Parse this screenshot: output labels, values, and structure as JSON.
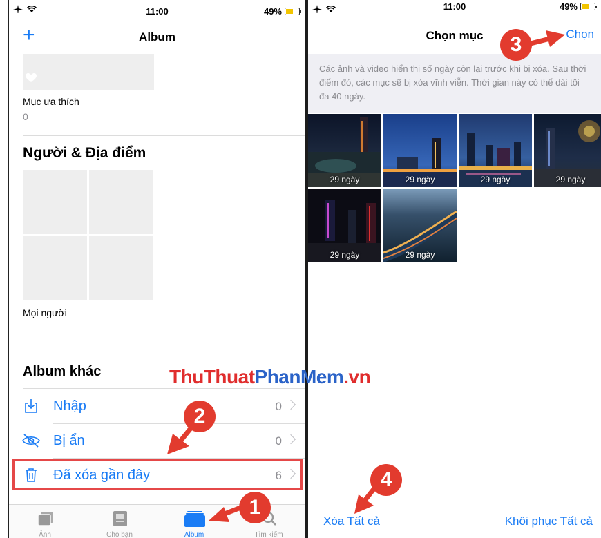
{
  "left_screen": {
    "status": {
      "time": "11:00",
      "battery": "49%",
      "battery_level": 0.49
    },
    "nav": {
      "title": "Album",
      "add_label": "+"
    },
    "favorites": {
      "label": "Mục ưa thích",
      "count": "0"
    },
    "people_places": {
      "title": "Người & Địa điểm",
      "people_label": "Mọi người"
    },
    "other_albums": {
      "title": "Album khác",
      "items": [
        {
          "label": "Nhập",
          "count": "0",
          "icon": "import-icon"
        },
        {
          "label": "Bị ẩn",
          "count": "0",
          "icon": "eye-slash-icon"
        },
        {
          "label": "Đã xóa gần đây",
          "count": "6",
          "icon": "trash-icon"
        }
      ]
    },
    "tabbar": {
      "tabs": [
        {
          "label": "Ảnh",
          "icon": "photos-icon",
          "active": false
        },
        {
          "label": "Cho bạn",
          "icon": "for-you-icon",
          "active": false
        },
        {
          "label": "Album",
          "icon": "album-icon",
          "active": true
        },
        {
          "label": "Tìm kiếm",
          "icon": "search-icon",
          "active": false
        }
      ]
    }
  },
  "right_screen": {
    "status": {
      "time": "11:00",
      "battery": "49%",
      "battery_level": 0.49
    },
    "nav": {
      "title": "Chọn mục",
      "select_label": "Chọn"
    },
    "info_text": "Các ảnh và video hiển thị số ngày còn lại trước khi bị xóa. Sau thời điểm đó, các mục sẽ bị xóa vĩnh viễn. Thời gian này có thể dài tối đa 40 ngày.",
    "photos": [
      {
        "days": "29 ngày"
      },
      {
        "days": "29 ngày"
      },
      {
        "days": "29 ngày"
      },
      {
        "days": "29 ngày"
      },
      {
        "days": "29 ngày"
      },
      {
        "days": "29 ngày"
      }
    ],
    "actions": {
      "delete_all": "Xóa Tất cả",
      "recover_all": "Khôi phục Tất cả"
    }
  },
  "annotations": {
    "steps": [
      "1",
      "2",
      "3",
      "4"
    ],
    "color": "#e23b2e"
  },
  "watermark": {
    "part1": "ThuThuat",
    "part2": "PhanMem",
    "part3": ".vn"
  },
  "colors": {
    "accent": "#1a7cf5",
    "highlight": "#e54848"
  }
}
